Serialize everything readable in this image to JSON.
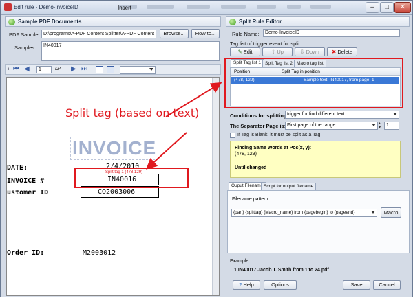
{
  "window": {
    "title": "Edit rule - Demo-InvoiceID",
    "blurred_menu": [
      "Insert",
      "Page layout",
      "References",
      "Mailings",
      "Review",
      "View",
      "Add-Ins"
    ]
  },
  "left": {
    "header": "Sample PDF Documents",
    "pdf_sample_label": "PDF Sample:",
    "pdf_sample_value": "D:\\programs\\A-PDF Content Splitter\\A-PDF Content Splitte",
    "browse_label": "Browse...",
    "howto_label": "How to...",
    "samples_label": "Samples:",
    "samples_value": "IN40017",
    "nav": {
      "page": "1",
      "total": "/24"
    },
    "doc": {
      "title": "INVOICE",
      "date_label": "DATE:",
      "date_value": "2/4/2010",
      "invoice_label": "INVOICE #",
      "invoice_value": "IN40016",
      "customer_label": "ustomer ID",
      "customer_value": "CO2003006",
      "order_label": "Order ID:",
      "order_value": "M2003012",
      "tag_label": "Split tag 1 (478,129)"
    }
  },
  "right": {
    "header": "Split Rule Editor",
    "rule_name_label": "Rule Name:",
    "rule_name_value": "Demo-InvoiceID",
    "tag_list_label": "Tag list of trigger event for split",
    "buttons": {
      "edit": "Edit",
      "up": "Up",
      "down": "Down",
      "delete": "Delete"
    },
    "tag_tabs": [
      "Split Tag list 1",
      "Split Tag list 2",
      "Macro tag list"
    ],
    "table": {
      "headers": [
        "Position",
        "Split Tag in position"
      ],
      "rows": [
        [
          "(478, 129)",
          "Sample text: IN40017, from page: 1"
        ]
      ]
    },
    "conditions_label": "Conditions for splitting:",
    "conditions_value": "trigger for find different text",
    "separator_label": "The Separator Page is:",
    "separator_value": "First page of the range",
    "separator_num": "1",
    "blank_check_label": "If Tag is Blank, it must be split as a Tag.",
    "summary": {
      "line1": "Finding Same Words at Pos(x, y):",
      "line2": "(478, 129)",
      "line3": "Until changed"
    },
    "output_tabs": [
      "Ouput Filename",
      "Script for output filename"
    ],
    "filename_pattern_label": "Filename pattern:",
    "filename_pattern_value": "{part} {splittag} {Macro_name} from {pagebegin} to {pageend}",
    "macro_button": "Macro",
    "example_label": "Example:",
    "example_value": "1 IN40017 Jacob T. Smith  from 1 to 24.pdf",
    "help_button": "Help",
    "options_button": "Options",
    "save_button": "Save",
    "cancel_button": "Cancel"
  },
  "annotation": {
    "text": "Split tag (based on text)",
    "color": "#e0191f"
  }
}
